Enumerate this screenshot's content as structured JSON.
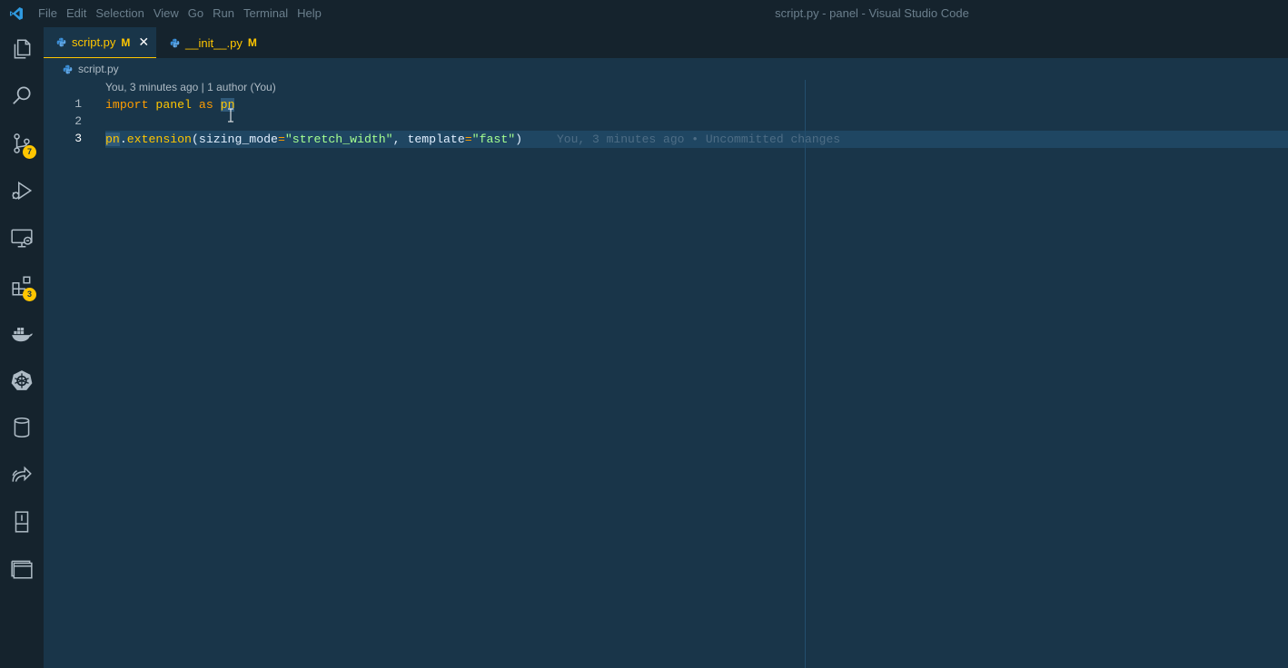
{
  "titlebar": {
    "menu": [
      "File",
      "Edit",
      "Selection",
      "View",
      "Go",
      "Run",
      "Terminal",
      "Help"
    ],
    "window_title": "script.py - panel - Visual Studio Code"
  },
  "activity_bar": {
    "items": [
      {
        "icon": "files-icon"
      },
      {
        "icon": "search-icon"
      },
      {
        "icon": "source-control-icon",
        "badge": "7"
      },
      {
        "icon": "run-debug-icon"
      },
      {
        "icon": "remote-explorer-icon"
      },
      {
        "icon": "extensions-icon",
        "badge": "3"
      },
      {
        "icon": "docker-icon"
      },
      {
        "icon": "kubernetes-icon"
      },
      {
        "icon": "database-icon"
      },
      {
        "icon": "live-share-icon"
      },
      {
        "icon": "notebook-icon"
      },
      {
        "icon": "panels-icon"
      }
    ]
  },
  "tabs": [
    {
      "name": "script.py",
      "modified": "M",
      "active": true
    },
    {
      "name": "__init__.py",
      "modified": "M",
      "active": false
    }
  ],
  "breadcrumb": {
    "file": "script.py"
  },
  "editor": {
    "codelens": "You, 3 minutes ago | 1 author (You)",
    "line_numbers": [
      "1",
      "2",
      "3"
    ],
    "line1": {
      "kw1": "import",
      "mod": "panel",
      "kw2": "as",
      "alias": "pn"
    },
    "line3": {
      "obj": "pn",
      "fn": "extension",
      "arg1": "sizing_mode",
      "val1": "\"stretch_width\"",
      "arg2": "template",
      "val2": "\"fast\""
    },
    "blame": "You, 3 minutes ago • Uncommitted changes"
  },
  "colors": {
    "background": "#193549",
    "accent": "#ffc600",
    "keyword": "#ff9d00",
    "string": "#a5ff90"
  }
}
